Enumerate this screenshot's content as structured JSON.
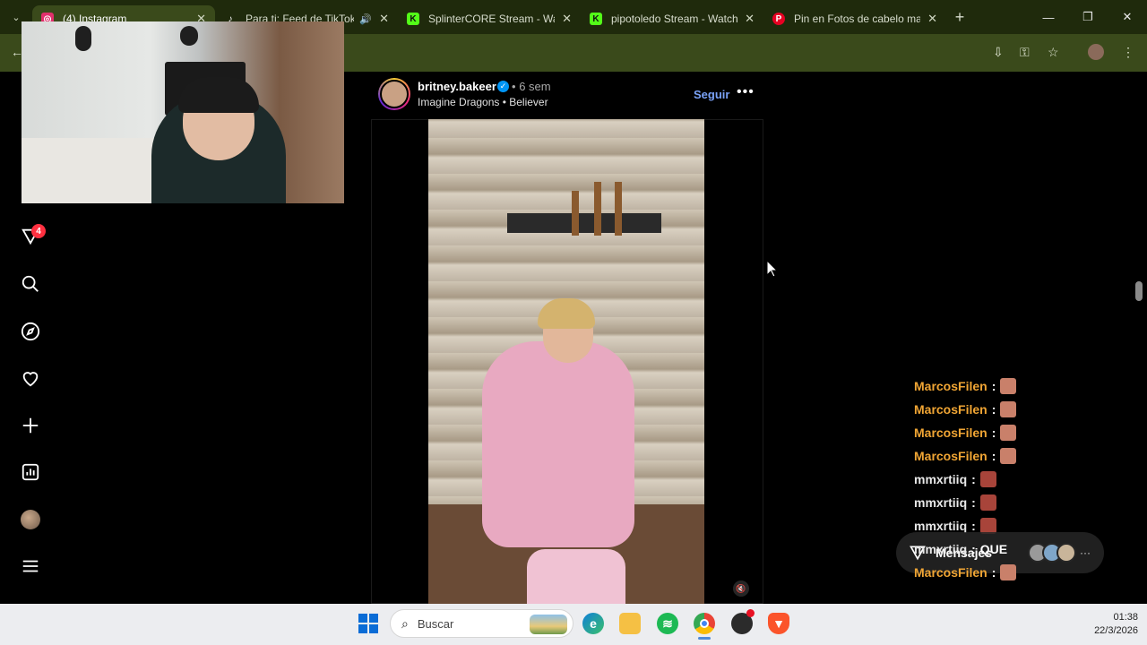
{
  "browser": {
    "tabs": [
      {
        "title": "(4) Instagram",
        "active": true,
        "favicon": "instagram-icon",
        "color": "#e1306c"
      },
      {
        "title": "Para ti: Feed de TikTok Li",
        "active": false,
        "favicon": "tiktok-icon",
        "color": "#111111",
        "audio": true
      },
      {
        "title": "SplinterCORE Stream - Watc",
        "active": false,
        "favicon": "kick-icon",
        "color": "#53fc18"
      },
      {
        "title": "pipotoledo Stream - Watch l",
        "active": false,
        "favicon": "kick-icon",
        "color": "#53fc18"
      },
      {
        "title": "Pin en Fotos de cabelo mas",
        "active": false,
        "favicon": "pinterest-icon",
        "color": "#e60023"
      }
    ],
    "new_tab_label": "+",
    "colors": {
      "tabbar": "#1f2a0c",
      "toolbar": "#3a4a1b"
    }
  },
  "sidebar": {
    "notification_count": "4",
    "items": [
      {
        "name": "direct-icon"
      },
      {
        "name": "search-icon"
      },
      {
        "name": "explore-icon"
      },
      {
        "name": "heart-icon"
      },
      {
        "name": "create-icon"
      },
      {
        "name": "stats-icon"
      },
      {
        "name": "profile-avatar"
      },
      {
        "name": "menu-icon"
      }
    ]
  },
  "post": {
    "username": "britney.bakeer",
    "separator": "•",
    "time_ago": "6 sem",
    "song": "Imagine Dragons • Believer",
    "follow_label": "Seguir",
    "more_label": "•••"
  },
  "chat": {
    "lines": [
      {
        "user": "MarcosFilen",
        "sep": ":",
        "emote": true,
        "style": "orange"
      },
      {
        "user": "MarcosFilen",
        "sep": ":",
        "emote": true,
        "style": "orange"
      },
      {
        "user": "MarcosFilen",
        "sep": ":",
        "emote": true,
        "style": "orange"
      },
      {
        "user": "MarcosFilen",
        "sep": ":",
        "emote": true,
        "style": "orange"
      },
      {
        "user": "mmxrtiiq",
        "sep": ":",
        "emote": true,
        "style": "white"
      },
      {
        "user": "mmxrtiiq",
        "sep": ":",
        "emote": true,
        "style": "white"
      },
      {
        "user": "mmxrtiiq",
        "sep": ":",
        "emote": true,
        "style": "white"
      },
      {
        "user": "mmxrtiiq",
        "sep": ":",
        "message": "QUE",
        "style": "white"
      },
      {
        "user": "MarcosFilen",
        "sep": ":",
        "emote": true,
        "style": "orange"
      }
    ]
  },
  "messages_pill": {
    "label": "Mensajes",
    "more": "···"
  },
  "taskbar": {
    "search_placeholder": "Buscar",
    "time": "01:38",
    "date": "22/3/2026"
  }
}
